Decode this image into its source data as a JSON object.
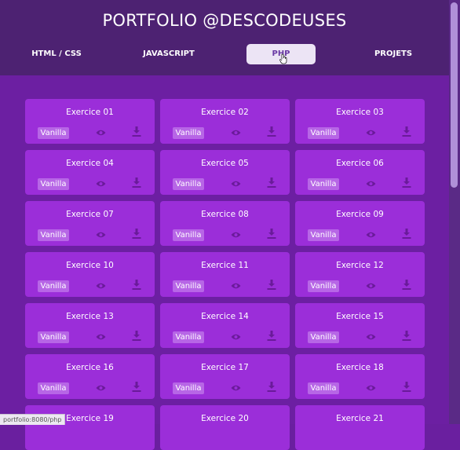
{
  "header": {
    "title": "PORTFOLIO @DESCODEUSES"
  },
  "nav": [
    {
      "label": "HTML / CSS"
    },
    {
      "label": "JAVASCRIPT"
    },
    {
      "label": "PHP",
      "active": true
    },
    {
      "label": "PROJETS"
    }
  ],
  "cards": [
    {
      "title": "Exercice 01",
      "tag": "Vanilla"
    },
    {
      "title": "Exercice 02",
      "tag": "Vanilla"
    },
    {
      "title": "Exercice 03",
      "tag": "Vanilla"
    },
    {
      "title": "Exercice 04",
      "tag": "Vanilla"
    },
    {
      "title": "Exercice 05",
      "tag": "Vanilla"
    },
    {
      "title": "Exercice 06",
      "tag": "Vanilla"
    },
    {
      "title": "Exercice 07",
      "tag": "Vanilla"
    },
    {
      "title": "Exercice 08",
      "tag": "Vanilla"
    },
    {
      "title": "Exercice 09",
      "tag": "Vanilla"
    },
    {
      "title": "Exercice 10",
      "tag": "Vanilla"
    },
    {
      "title": "Exercice 11",
      "tag": "Vanilla"
    },
    {
      "title": "Exercice 12",
      "tag": "Vanilla"
    },
    {
      "title": "Exercice 13",
      "tag": "Vanilla"
    },
    {
      "title": "Exercice 14",
      "tag": "Vanilla"
    },
    {
      "title": "Exercice 15",
      "tag": "Vanilla"
    },
    {
      "title": "Exercice 16",
      "tag": "Vanilla"
    },
    {
      "title": "Exercice 17",
      "tag": "Vanilla"
    },
    {
      "title": "Exercice 18",
      "tag": "Vanilla"
    },
    {
      "title": "Exercice 19"
    },
    {
      "title": "Exercice 20"
    },
    {
      "title": "Exercice 21"
    }
  ],
  "status_url": "portfolio:8080/php",
  "colors": {
    "header_bg": "#4d2272",
    "content_bg": "#6c1fa2",
    "card_bg": "#9b2ed9",
    "tag_bg": "#b766e6",
    "active_tab_bg": "#ece4f5",
    "icon": "#6a1a9a"
  }
}
